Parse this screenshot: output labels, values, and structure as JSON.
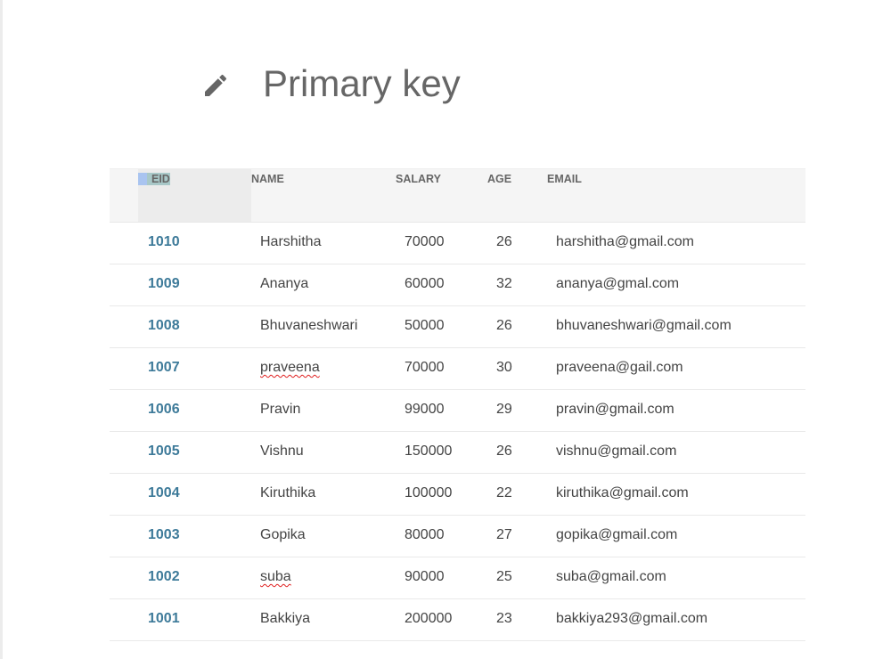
{
  "title": "Primary key",
  "table": {
    "headers": [
      "EID",
      "NAME",
      "SALARY",
      "AGE",
      "EMAIL"
    ],
    "rows": [
      {
        "eid": "1010",
        "name": "Harshitha",
        "salary": "70000",
        "age": "26",
        "email": "harshitha@gmail.com"
      },
      {
        "eid": "1009",
        "name": "Ananya",
        "salary": "60000",
        "age": "32",
        "email": "ananya@gmal.com"
      },
      {
        "eid": "1008",
        "name": "Bhuvaneshwari",
        "salary": "50000",
        "age": "26",
        "email": "bhuvaneshwari@gmail.com"
      },
      {
        "eid": "1007",
        "name": "praveena",
        "salary": "70000",
        "age": "30",
        "email": "praveena@gail.com",
        "spell": true
      },
      {
        "eid": "1006",
        "name": "Pravin",
        "salary": "99000",
        "age": "29",
        "email": "pravin@gmail.com"
      },
      {
        "eid": "1005",
        "name": "Vishnu",
        "salary": "150000",
        "age": "26",
        "email": "vishnu@gmail.com"
      },
      {
        "eid": "1004",
        "name": "Kiruthika",
        "salary": "100000",
        "age": "22",
        "email": "kiruthika@gmail.com"
      },
      {
        "eid": "1003",
        "name": "Gopika",
        "salary": "80000",
        "age": "27",
        "email": "gopika@gmail.com"
      },
      {
        "eid": "1002",
        "name": "suba",
        "salary": "90000",
        "age": "25",
        "email": "suba@gmail.com",
        "spell": true
      },
      {
        "eid": "1001",
        "name": "Bakkiya",
        "salary": "200000",
        "age": "23",
        "email": "bakkiya293@gmail.com"
      }
    ]
  }
}
